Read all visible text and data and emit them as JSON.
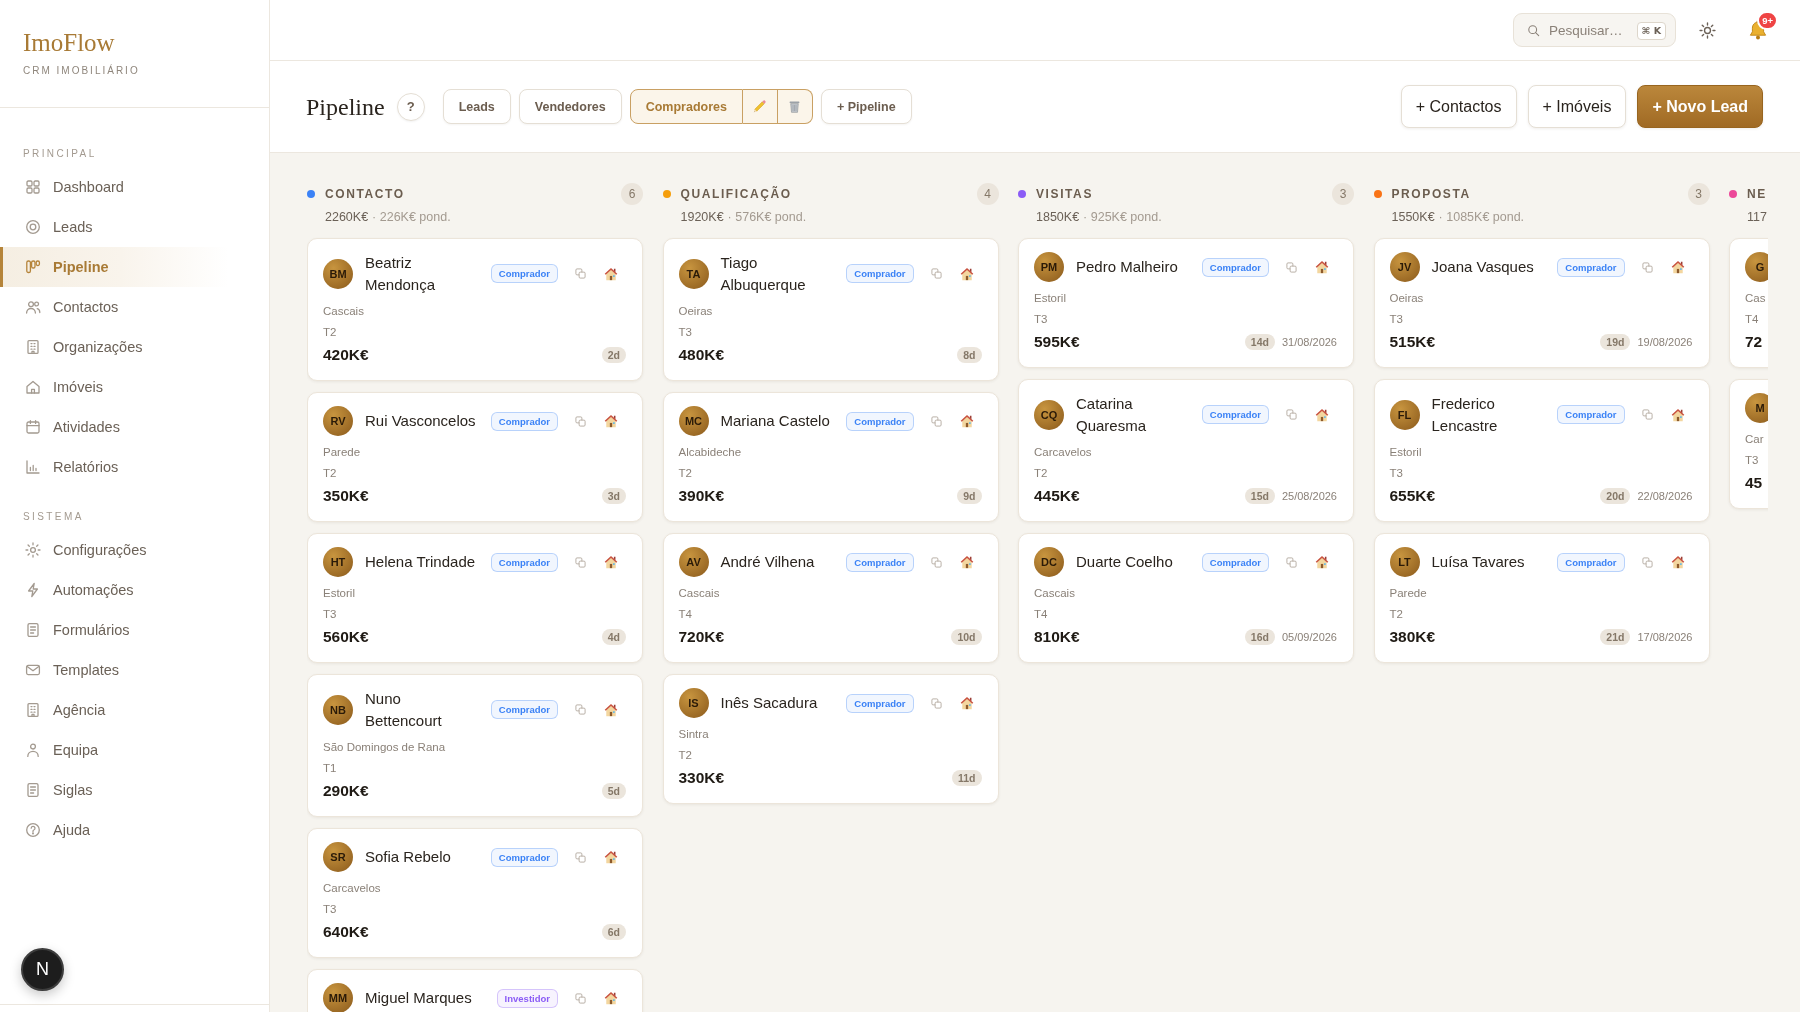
{
  "sidebar": {
    "logo": "ImoFlow",
    "tagline": "CRM IMOBILIÁRIO",
    "sections": [
      {
        "title": "PRINCIPAL",
        "items": [
          {
            "label": "Dashboard",
            "selected": false
          },
          {
            "label": "Leads",
            "selected": false
          },
          {
            "label": "Pipeline",
            "selected": true
          },
          {
            "label": "Contactos",
            "selected": false
          },
          {
            "label": "Organizações",
            "selected": false
          },
          {
            "label": "Imóveis",
            "selected": false
          },
          {
            "label": "Atividades",
            "selected": false
          },
          {
            "label": "Relatórios",
            "selected": false
          }
        ]
      },
      {
        "title": "SISTEMA",
        "items": [
          {
            "label": "Configurações",
            "selected": false
          },
          {
            "label": "Automações",
            "selected": false
          },
          {
            "label": "Formulários",
            "selected": false
          },
          {
            "label": "Templates",
            "selected": false
          },
          {
            "label": "Agência",
            "selected": false
          },
          {
            "label": "Equipa",
            "selected": false
          },
          {
            "label": "Siglas",
            "selected": false
          },
          {
            "label": "Ajuda",
            "selected": false
          }
        ]
      }
    ],
    "dev_button": "N"
  },
  "topbar": {
    "search": {
      "placeholder": "Pesquisar…",
      "shortcut": "⌘ K"
    },
    "notifications": "9+"
  },
  "toolbar": {
    "title": "Pipeline",
    "help": "?",
    "pipelines": [
      {
        "label": "Leads",
        "selected": false
      },
      {
        "label": "Vendedores",
        "selected": false
      },
      {
        "label": "Compradores",
        "selected": true
      }
    ],
    "add_pipeline": "+ Pipeline",
    "actions": [
      {
        "label": "+ Contactos",
        "kind": "secondary"
      },
      {
        "label": "+ Imóveis",
        "kind": "secondary"
      },
      {
        "label": "+ Novo Lead",
        "kind": "primary"
      }
    ]
  },
  "columns": [
    {
      "title": "CONTACTO",
      "color": "#3b82f6",
      "count": "6",
      "total": "2260K€",
      "weighted": "· 226K€ pond.",
      "cards": [
        {
          "initials": "BM",
          "name": "Beatriz Mendonça",
          "tag": {
            "label": "Comprador",
            "color": "#3b82f6"
          },
          "location": "Cascais",
          "type": "T2",
          "price": "420K€",
          "age": "2d"
        },
        {
          "initials": "RV",
          "name": "Rui Vasconcelos",
          "tag": {
            "label": "Comprador",
            "color": "#3b82f6"
          },
          "location": "Parede",
          "type": "T2",
          "price": "350K€",
          "age": "3d"
        },
        {
          "initials": "HT",
          "name": "Helena Trindade",
          "tag": {
            "label": "Comprador",
            "color": "#3b82f6"
          },
          "location": "Estoril",
          "type": "T3",
          "price": "560K€",
          "age": "4d"
        },
        {
          "initials": "NB",
          "name": "Nuno Bettencourt",
          "tag": {
            "label": "Comprador",
            "color": "#3b82f6"
          },
          "location": "São Domingos de Rana",
          "type": "T1",
          "price": "290K€",
          "age": "5d"
        },
        {
          "initials": "SR",
          "name": "Sofia Rebelo",
          "tag": {
            "label": "Comprador",
            "color": "#3b82f6"
          },
          "location": "Carcavelos",
          "type": "T3",
          "price": "640K€",
          "age": "6d"
        },
        {
          "initials": "MM",
          "name": "Miguel Marques",
          "tag": {
            "label": "Investidor",
            "color": "#8b5cf6"
          }
        }
      ]
    },
    {
      "title": "QUALIFICAÇÃO",
      "color": "#f59e0b",
      "count": "4",
      "total": "1920K€",
      "weighted": "· 576K€ pond.",
      "cards": [
        {
          "initials": "TA",
          "name": "Tiago Albuquerque",
          "tag": {
            "label": "Comprador",
            "color": "#3b82f6"
          },
          "location": "Oeiras",
          "type": "T3",
          "price": "480K€",
          "age": "8d"
        },
        {
          "initials": "MC",
          "name": "Mariana Castelo",
          "tag": {
            "label": "Comprador",
            "color": "#3b82f6"
          },
          "location": "Alcabideche",
          "type": "T2",
          "price": "390K€",
          "age": "9d"
        },
        {
          "initials": "AV",
          "name": "André Vilhena",
          "tag": {
            "label": "Comprador",
            "color": "#3b82f6"
          },
          "location": "Cascais",
          "type": "T4",
          "price": "720K€",
          "age": "10d"
        },
        {
          "initials": "IS",
          "name": "Inês Sacadura",
          "tag": {
            "label": "Comprador",
            "color": "#3b82f6"
          },
          "location": "Sintra",
          "type": "T2",
          "price": "330K€",
          "age": "11d"
        }
      ]
    },
    {
      "title": "VISITAS",
      "color": "#8b5cf6",
      "count": "3",
      "total": "1850K€",
      "weighted": "· 925K€ pond.",
      "cards": [
        {
          "initials": "PM",
          "name": "Pedro Malheiro",
          "tag": {
            "label": "Comprador",
            "color": "#3b82f6"
          },
          "location": "Estoril",
          "type": "T3",
          "price": "595K€",
          "age": "14d",
          "date": "31/08/2026"
        },
        {
          "initials": "CQ",
          "name": "Catarina Quaresma",
          "tag": {
            "label": "Comprador",
            "color": "#3b82f6"
          },
          "location": "Carcavelos",
          "type": "T2",
          "price": "445K€",
          "age": "15d",
          "date": "25/08/2026"
        },
        {
          "initials": "DC",
          "name": "Duarte Coelho",
          "tag": {
            "label": "Comprador",
            "color": "#3b82f6"
          },
          "location": "Cascais",
          "type": "T4",
          "price": "810K€",
          "age": "16d",
          "date": "05/09/2026"
        }
      ]
    },
    {
      "title": "PROPOSTA",
      "color": "#f97316",
      "count": "3",
      "total": "1550K€",
      "weighted": "· 1085K€ pond.",
      "cards": [
        {
          "initials": "JV",
          "name": "Joana Vasques",
          "tag": {
            "label": "Comprador",
            "color": "#3b82f6"
          },
          "location": "Oeiras",
          "type": "T3",
          "price": "515K€",
          "age": "19d",
          "date": "19/08/2026"
        },
        {
          "initials": "FL",
          "name": "Frederico Lencastre",
          "tag": {
            "label": "Comprador",
            "color": "#3b82f6"
          },
          "location": "Estoril",
          "type": "T3",
          "price": "655K€",
          "age": "20d",
          "date": "22/08/2026"
        },
        {
          "initials": "LT",
          "name": "Luísa Tavares",
          "tag": {
            "label": "Comprador",
            "color": "#3b82f6"
          },
          "location": "Parede",
          "type": "T2",
          "price": "380K€",
          "age": "21d",
          "date": "17/08/2026"
        }
      ]
    },
    {
      "title": "NE",
      "color": "#ec4899",
      "total": "117",
      "cards": [
        {
          "initials": "G",
          "location": "Cas",
          "type": "T4",
          "price": "72"
        },
        {
          "initials": "M",
          "location": "Car",
          "type": "T3",
          "price": "45"
        }
      ]
    }
  ]
}
